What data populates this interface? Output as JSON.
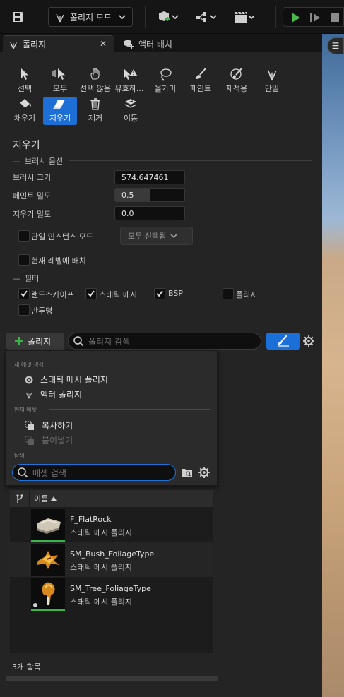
{
  "toolbar": {
    "mode_label": "폴리지 모드"
  },
  "tabs": [
    {
      "label": "폴리지",
      "active": true
    },
    {
      "label": "액터 배치",
      "active": false
    }
  ],
  "tools": [
    {
      "label": "선택",
      "icon": "cursor-icon"
    },
    {
      "label": "모두",
      "icon": "select-all-icon"
    },
    {
      "label": "선택 않음",
      "icon": "deselect-icon"
    },
    {
      "label": "유효하...",
      "icon": "invalid-select-icon"
    },
    {
      "label": "올가미",
      "icon": "lasso-icon"
    },
    {
      "label": "페인트",
      "icon": "paint-brush-icon"
    },
    {
      "label": "재적용",
      "icon": "reapply-icon"
    },
    {
      "label": "단일",
      "icon": "single-foliage-icon"
    },
    {
      "label": "채우기",
      "icon": "fill-bucket-icon"
    },
    {
      "label": "지우기",
      "icon": "eraser-icon",
      "selected": true
    },
    {
      "label": "제거",
      "icon": "trash-icon"
    },
    {
      "label": "이동",
      "icon": "move-icon"
    }
  ],
  "section_title": "지우기",
  "brush_options": {
    "header": "브러시 옵션",
    "brush_size_label": "브러시 크기",
    "brush_size_value": "574.647461",
    "paint_density_label": "페인트 밀도",
    "paint_density_value": "0.5",
    "paint_density_fill": 0.5,
    "erase_density_label": "지우기 밀도",
    "erase_density_value": "0.0",
    "single_instance_label": "단일 인스턴스 모드",
    "single_instance_checked": false,
    "select_all_combo": "모두 선택됨",
    "place_current_level_label": "현재 레벨에 배치",
    "place_current_level_checked": false
  },
  "filter": {
    "header": "필터",
    "items": [
      {
        "label": "랜드스케이프",
        "checked": true
      },
      {
        "label": "스태틱 메시",
        "checked": true
      },
      {
        "label": "BSP",
        "checked": true
      },
      {
        "label": "폴리지",
        "checked": false
      },
      {
        "label": "반투명",
        "checked": false
      }
    ]
  },
  "foliage_bar": {
    "add_label": "폴리지",
    "search_placeholder": "폴리지 검색"
  },
  "dropdown": {
    "new_asset_header": "새 에셋 생성",
    "new_items": [
      {
        "label": "스태틱 메시 폴리지",
        "icon": "static-mesh-icon"
      },
      {
        "label": "액터 폴리지",
        "icon": "actor-foliage-icon"
      }
    ],
    "current_asset_header": "현재 에셋",
    "current_items": [
      {
        "label": "복사하기",
        "icon": "copy-icon",
        "enabled": true
      },
      {
        "label": "붙여넣기",
        "icon": "paste-icon",
        "enabled": false
      }
    ],
    "browse_header": "탐색",
    "asset_search_placeholder": "에셋 검색"
  },
  "list": {
    "column_name": "이름",
    "rows": [
      {
        "name": "F_FlatRock",
        "type": "스태틱 메시 폴리지"
      },
      {
        "name": "SM_Bush_FoliageType",
        "type": "스태틱 메시 폴리지"
      },
      {
        "name": "SM_Tree_FoliageType",
        "type": "스태틱 메시 폴리지"
      }
    ],
    "count_label": "3개 항목"
  },
  "colors": {
    "accent": "#1d6fd6",
    "panel_bg": "#242424",
    "active_green": "#39b54a"
  }
}
